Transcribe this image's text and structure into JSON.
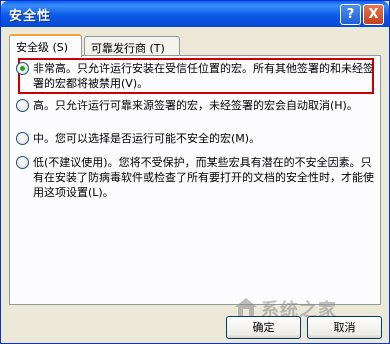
{
  "window": {
    "title": "安全性",
    "help_label": "?",
    "close_label": "X"
  },
  "tabs": [
    {
      "label": "安全级 (S)"
    },
    {
      "label": "可靠发行商 (T)"
    }
  ],
  "options": [
    {
      "text": "非常高。只允许运行安装在受信任位置的宏。所有其他签署的和未经签署的宏都将被禁用(V)。",
      "checked": true
    },
    {
      "text": "高。只允许运行可靠来源签署的宏，未经签署的宏会自动取消(H)。",
      "checked": false
    },
    {
      "text": "中。您可以选择是否运行可能不安全的宏(M)。",
      "checked": false
    },
    {
      "text": "低(不建议使用)。您将不受保护，而某些宏具有潜在的不安全因素。只有在安装了防病毒软件或检查了所有要打开的文档的安全性时，才能使用这项设置(L)。",
      "checked": false
    }
  ],
  "buttons": {
    "ok": "确定",
    "cancel": "取消"
  },
  "watermark": {
    "text": "系统之家"
  },
  "colors": {
    "highlight": "#c80000",
    "titlebar": "#0a5ae8"
  }
}
